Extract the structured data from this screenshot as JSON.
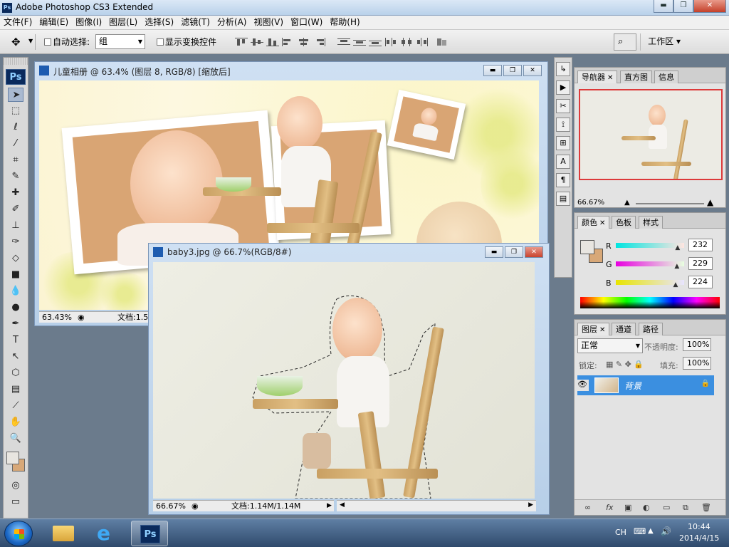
{
  "app": {
    "title": "Adobe Photoshop CS3 Extended",
    "logo_text": "Ps"
  },
  "window_controls": {
    "minimize": "▬",
    "restore": "❐",
    "close": "✕"
  },
  "menu": [
    "文件(F)",
    "编辑(E)",
    "图像(I)",
    "图层(L)",
    "选择(S)",
    "滤镜(T)",
    "分析(A)",
    "视图(V)",
    "窗口(W)",
    "帮助(H)"
  ],
  "options": {
    "auto_select_label": "自动选择:",
    "auto_select_value": "组",
    "show_transform_label": "显示变换控件",
    "workspace_label": "工作区 ▾"
  },
  "doc1": {
    "title": "儿童相册 @ 63.4% (图层 8, RGB/8) [缩放后]",
    "zoom": "63.43%",
    "docinfo": "文档:1.5"
  },
  "doc2": {
    "title": "baby3.jpg @ 66.7%(RGB/8#)",
    "zoom": "66.67%",
    "docinfo": "文档:1.14M/1.14M"
  },
  "navigator": {
    "tabs": [
      "导航器",
      "直方图",
      "信息"
    ],
    "zoom": "66.67%"
  },
  "color_panel": {
    "tabs": [
      "颜色",
      "色板",
      "样式"
    ],
    "r_label": "R",
    "g_label": "G",
    "b_label": "B",
    "r": "232",
    "g": "229",
    "b": "224",
    "r_level": 0.91,
    "g_level": 0.9,
    "b_level": 0.88,
    "fg_color": "#e8e5e0",
    "bg_color": "#d8a878"
  },
  "layers_panel": {
    "tabs": [
      "图层",
      "通道",
      "路径"
    ],
    "blend_mode": "正常",
    "opacity_label": "不透明度:",
    "opacity": "100%",
    "lock_label": "锁定:",
    "fill_label": "填充:",
    "fill": "100%",
    "layer_name": "背景"
  },
  "tray": {
    "lang": "CH",
    "time": "10:44",
    "date": "2014/4/15"
  },
  "colors": {
    "selection_blue": "#3b8fe0",
    "navigator_border": "#dd3a3a"
  }
}
